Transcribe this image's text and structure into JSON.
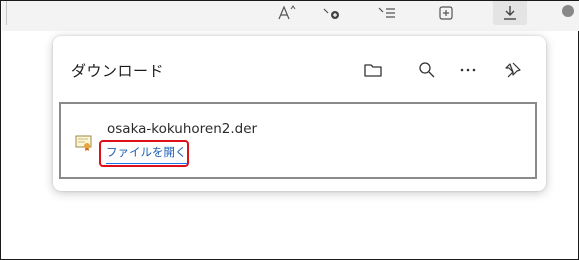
{
  "toolbar": {
    "icons": [
      {
        "name": "read-aloud-icon",
        "glyph": "Aˆ"
      },
      {
        "name": "add-favorite-icon",
        "glyph": "☆+"
      },
      {
        "name": "favorites-icon",
        "glyph": "☆≡"
      },
      {
        "name": "collections-icon",
        "glyph": "⊞"
      },
      {
        "name": "downloads-icon",
        "glyph": "⤓"
      },
      {
        "name": "profile-icon",
        "glyph": "☺"
      }
    ]
  },
  "downloads": {
    "title": "ダウンロード",
    "buttons": [
      {
        "name": "open-downloads-folder-icon"
      },
      {
        "name": "search-downloads-icon"
      },
      {
        "name": "more-options-icon"
      },
      {
        "name": "pin-icon"
      }
    ],
    "item": {
      "file_name": "osaka-kokuhoren2.der",
      "action_label": "ファイルを開く",
      "file_icon": "certificate-icon"
    }
  },
  "colors": {
    "link": "#1a5fb4",
    "highlight": "#e0101a",
    "border": "#8a8a8a"
  }
}
